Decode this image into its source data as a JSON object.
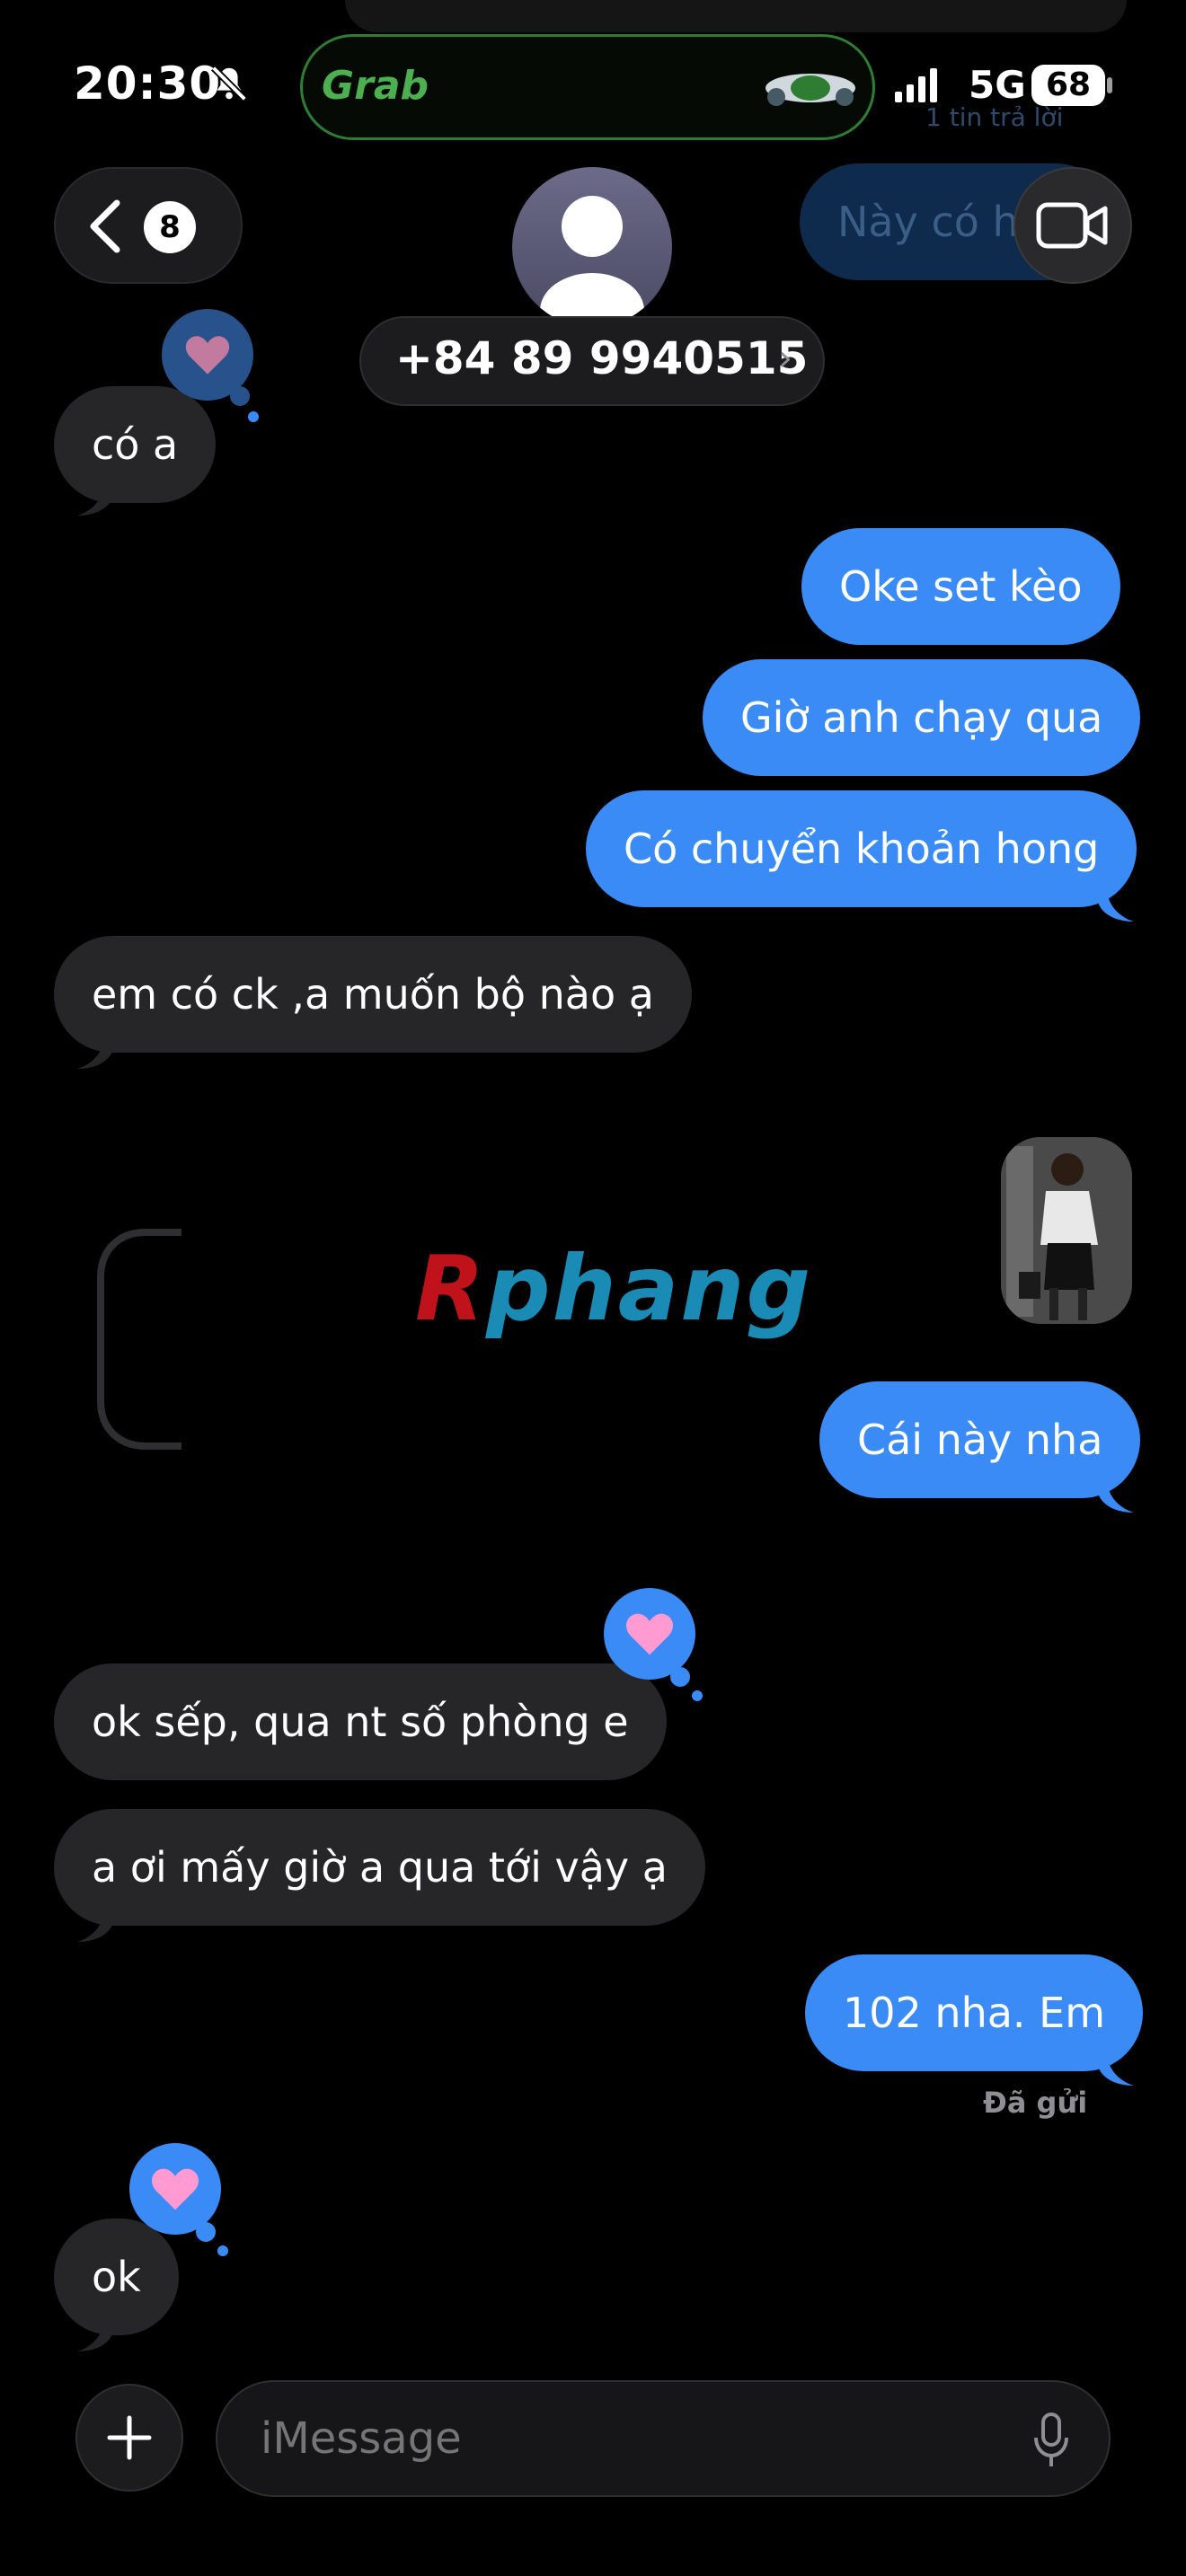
{
  "status_bar": {
    "time": "20:30",
    "live_activity_app": "Grab",
    "network": "5G",
    "battery": "68"
  },
  "background_notification": {
    "bubble_text": "Này có h",
    "reply_text": "1 tin trả lời"
  },
  "nav": {
    "back_badge": "8",
    "contact_name": "+84 89 9940515",
    "contact_chevron": "›"
  },
  "messages": [
    {
      "id": "m1",
      "from": "contact",
      "text": "có a",
      "tapback": "heart"
    },
    {
      "id": "m2",
      "from": "me",
      "text": "Oke set kèo"
    },
    {
      "id": "m3",
      "from": "me",
      "text": "Giờ anh chạy qua"
    },
    {
      "id": "m4",
      "from": "me",
      "text": "Có chuyển khoản hong"
    },
    {
      "id": "m5",
      "from": "contact",
      "text": "em có ck ,a muốn bộ nào ạ"
    },
    {
      "id": "m6",
      "from": "me",
      "text": "Cái này nha"
    },
    {
      "id": "m7",
      "from": "contact",
      "text": "ok sếp, qua nt số phòng e",
      "tapback": "heart"
    },
    {
      "id": "m8",
      "from": "contact",
      "text": "a ơi mấy giờ a qua tới vậy ạ"
    },
    {
      "id": "m9",
      "from": "me",
      "text": "102 nha. Em"
    },
    {
      "id": "m10",
      "from": "contact",
      "text": "ok",
      "tapback": "heart"
    }
  ],
  "watermark": {
    "first": "R",
    "rest": "phang"
  },
  "delivery_status": "Đã gửi",
  "composer": {
    "placeholder": "iMessage"
  },
  "colors": {
    "sent_bubble": "#3a8bf6",
    "received_bubble": "#262628",
    "tapback_heart": "#ff9bd2"
  },
  "icons": [
    "bell-slash-icon",
    "scooter-icon",
    "signal-icon",
    "chevron-left-icon",
    "person-icon",
    "video-camera-icon",
    "heart-icon",
    "plus-icon",
    "microphone-icon"
  ]
}
